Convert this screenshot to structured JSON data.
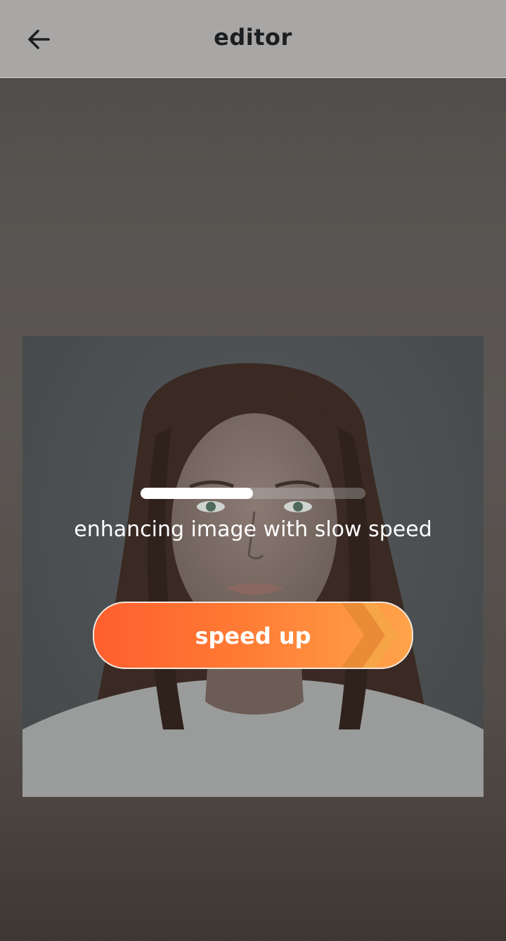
{
  "header": {
    "title": "editor",
    "back_icon": "arrow-left-icon"
  },
  "photo": {
    "subject": "portrait-photo"
  },
  "progress": {
    "fraction": 0.5
  },
  "status": {
    "text": "enhancing image with slow speed"
  },
  "speed_button": {
    "label": "speed up",
    "icon": "double-chevron-right-icon",
    "gradient_start": "#ff5f2e",
    "gradient_end": "#ffa44a"
  }
}
